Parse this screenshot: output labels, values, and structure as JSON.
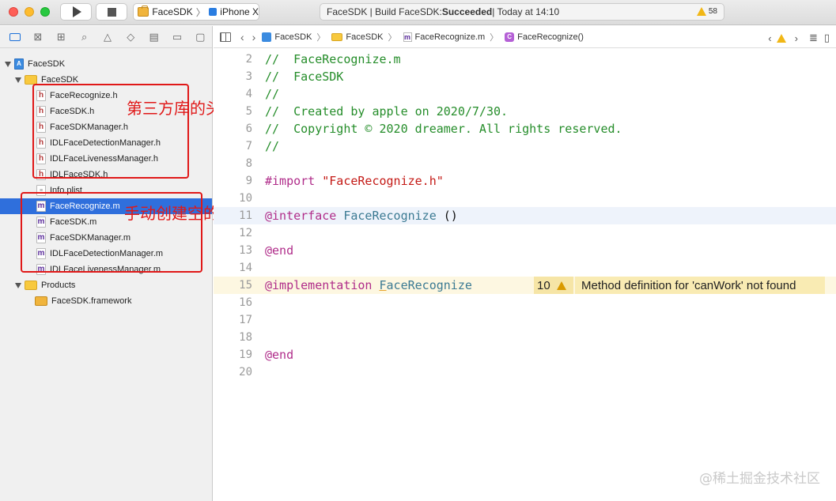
{
  "toolbar": {
    "scheme_project": "FaceSDK",
    "scheme_separator": "〉",
    "scheme_device": "iPhone X",
    "status_prefix": "FaceSDK | Build FaceSDK: ",
    "status_result": "Succeeded",
    "status_suffix": " | Today at 14:10",
    "warning_count": "58"
  },
  "navigator": {
    "items": [
      {
        "label": "FaceSDK",
        "kind": "project"
      },
      {
        "label": "FaceSDK",
        "kind": "group"
      },
      {
        "label": "FaceRecognize.h",
        "kind": "h"
      },
      {
        "label": "FaceSDK.h",
        "kind": "h"
      },
      {
        "label": "FaceSDKManager.h",
        "kind": "h"
      },
      {
        "label": "IDLFaceDetectionManager.h",
        "kind": "h"
      },
      {
        "label": "IDLFaceLivenessManager.h",
        "kind": "h"
      },
      {
        "label": "IDLFaceSDK.h",
        "kind": "h"
      },
      {
        "label": "Info.plist",
        "kind": "plist"
      },
      {
        "label": "FaceRecognize.m",
        "kind": "m"
      },
      {
        "label": "FaceSDK.m",
        "kind": "m"
      },
      {
        "label": "FaceSDKManager.m",
        "kind": "m"
      },
      {
        "label": "IDLFaceDetectionManager.m",
        "kind": "m"
      },
      {
        "label": "IDLFaceLivenessManager.m",
        "kind": "m"
      },
      {
        "label": "Products",
        "kind": "group"
      },
      {
        "label": "FaceSDK.framework",
        "kind": "framework"
      }
    ],
    "icon_letters": {
      "h": "h",
      "m": "m"
    }
  },
  "annotations": {
    "headers_note": "第三方库的头文件拷贝进来",
    "impl_note": "手动创建空的实现文件"
  },
  "jumpbar": {
    "crumb_project": "FaceSDK",
    "crumb_group": "FaceSDK",
    "crumb_file": "FaceRecognize.m",
    "crumb_symbol": "FaceRecognize()",
    "sep": "〉"
  },
  "editor": {
    "lines": [
      {
        "num": "2",
        "text": "//  FaceRecognize.m"
      },
      {
        "num": "3",
        "text": "//  FaceSDK"
      },
      {
        "num": "4",
        "text": "//"
      },
      {
        "num": "5",
        "text": "//  Created by apple on 2020/7/30."
      },
      {
        "num": "6",
        "text": "//  Copyright © 2020 dreamer. All rights reserved."
      },
      {
        "num": "7",
        "text": "//"
      },
      {
        "num": "8",
        "text": ""
      },
      {
        "num": "9",
        "kw": "#import",
        "string": "\"FaceRecognize.h\""
      },
      {
        "num": "10",
        "text": ""
      },
      {
        "num": "11",
        "kw": "@interface",
        "type": "FaceRecognize",
        "rest": " ()"
      },
      {
        "num": "12",
        "text": ""
      },
      {
        "num": "13",
        "kw": "@end"
      },
      {
        "num": "14",
        "text": ""
      },
      {
        "num": "15",
        "kw": "@implementation",
        "type_first": "F",
        "type_rest": "aceRecognize"
      },
      {
        "num": "16",
        "text": ""
      },
      {
        "num": "17",
        "text": ""
      },
      {
        "num": "18",
        "text": ""
      },
      {
        "num": "19",
        "kw": "@end"
      },
      {
        "num": "20",
        "text": ""
      }
    ],
    "warning": {
      "count": "10",
      "message": "Method definition for 'canWork' not found"
    }
  },
  "watermark": "@稀土掘金技术社区",
  "colors": {
    "selection": "#2f6fdc",
    "annotation": "#e01818",
    "comment": "#258d2a",
    "keyword": "#b02d8a",
    "string": "#c41a16"
  }
}
